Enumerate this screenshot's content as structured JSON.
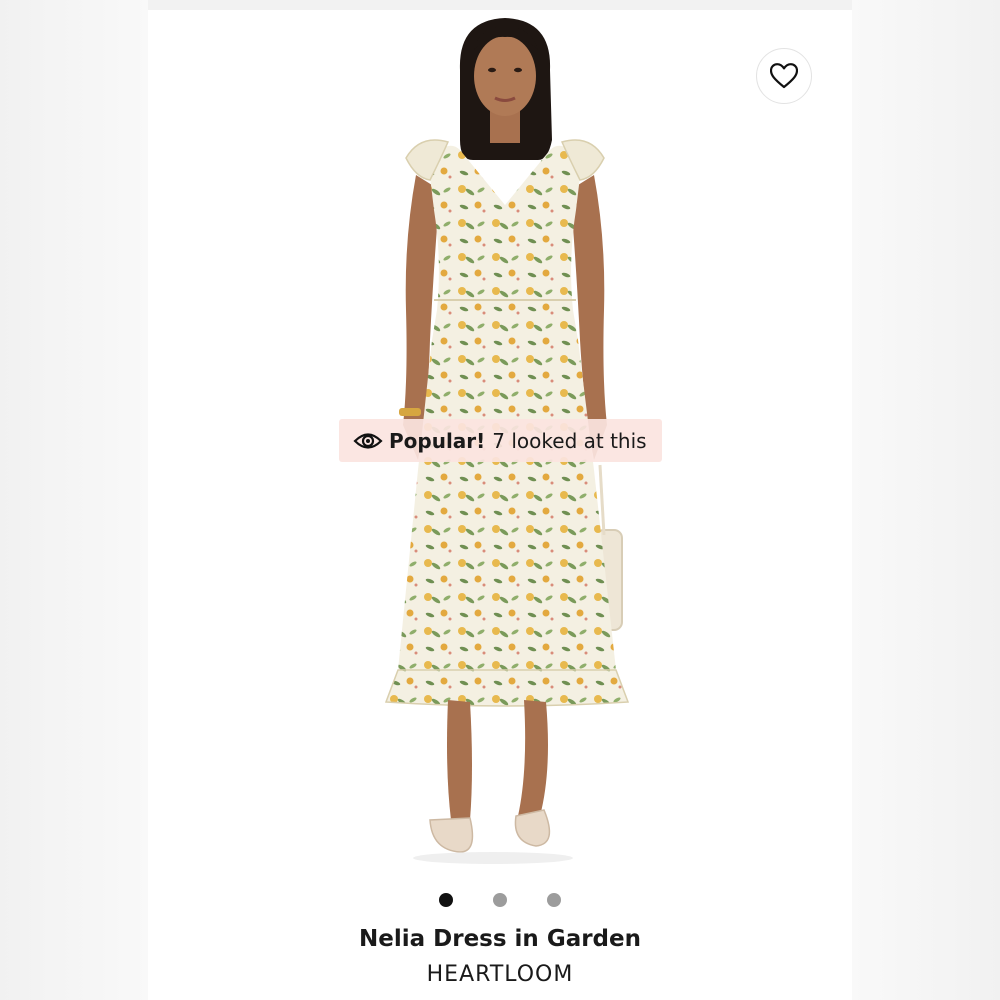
{
  "favorite": {
    "icon": "heart-icon"
  },
  "badge": {
    "icon": "eye-icon",
    "label": "Popular!",
    "text": "7 looked at this",
    "background": "#fbe4e0"
  },
  "carousel": {
    "dots": [
      {
        "active": true
      },
      {
        "active": false
      },
      {
        "active": false
      }
    ]
  },
  "product": {
    "name": "Nelia Dress in Garden",
    "brand": "HEARTLOOM"
  },
  "colors": {
    "dress_base": "#f4f0e2",
    "flower_yellow": "#e8b94e",
    "leaf_green": "#7a9a5a",
    "skin": "#a8714f",
    "hair": "#1e1612"
  }
}
